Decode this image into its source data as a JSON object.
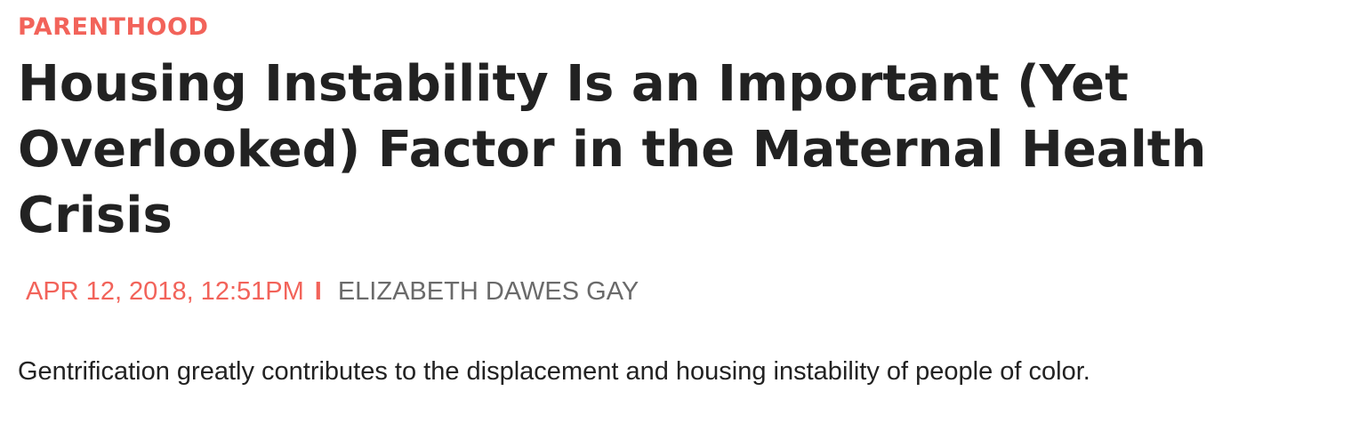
{
  "article": {
    "category": "PARENTHOOD",
    "headline": "Housing Instability Is an Important (Yet Overlooked) Factor in the Maternal Health Crisis",
    "byline": {
      "date": "APR 12, 2018, 12:51PM",
      "separator": "I",
      "author": "ELIZABETH DAWES GAY"
    },
    "dek": "Gentrification greatly contributes to the displacement and housing instability of people of color."
  },
  "colors": {
    "accent": "#f2635a",
    "headline": "#222222",
    "author": "#6a6a6a",
    "background": "#ffffff"
  }
}
